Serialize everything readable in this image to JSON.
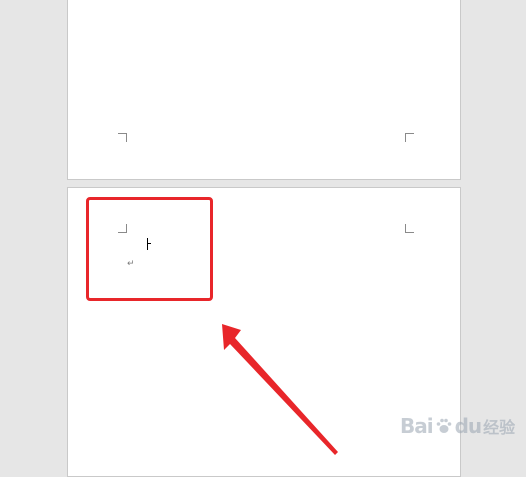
{
  "document": {
    "pages": [
      "page-1",
      "page-2"
    ],
    "paragraph_mark": "↵"
  },
  "annotation": {
    "highlight_color": "#e8262a",
    "arrow_color": "#e8262a"
  },
  "watermark": {
    "brand": "Bai",
    "brand2": "du",
    "suffix": "经验",
    "icon": "paw-icon"
  },
  "colors": {
    "background": "#e6e6e6",
    "page": "#ffffff"
  }
}
